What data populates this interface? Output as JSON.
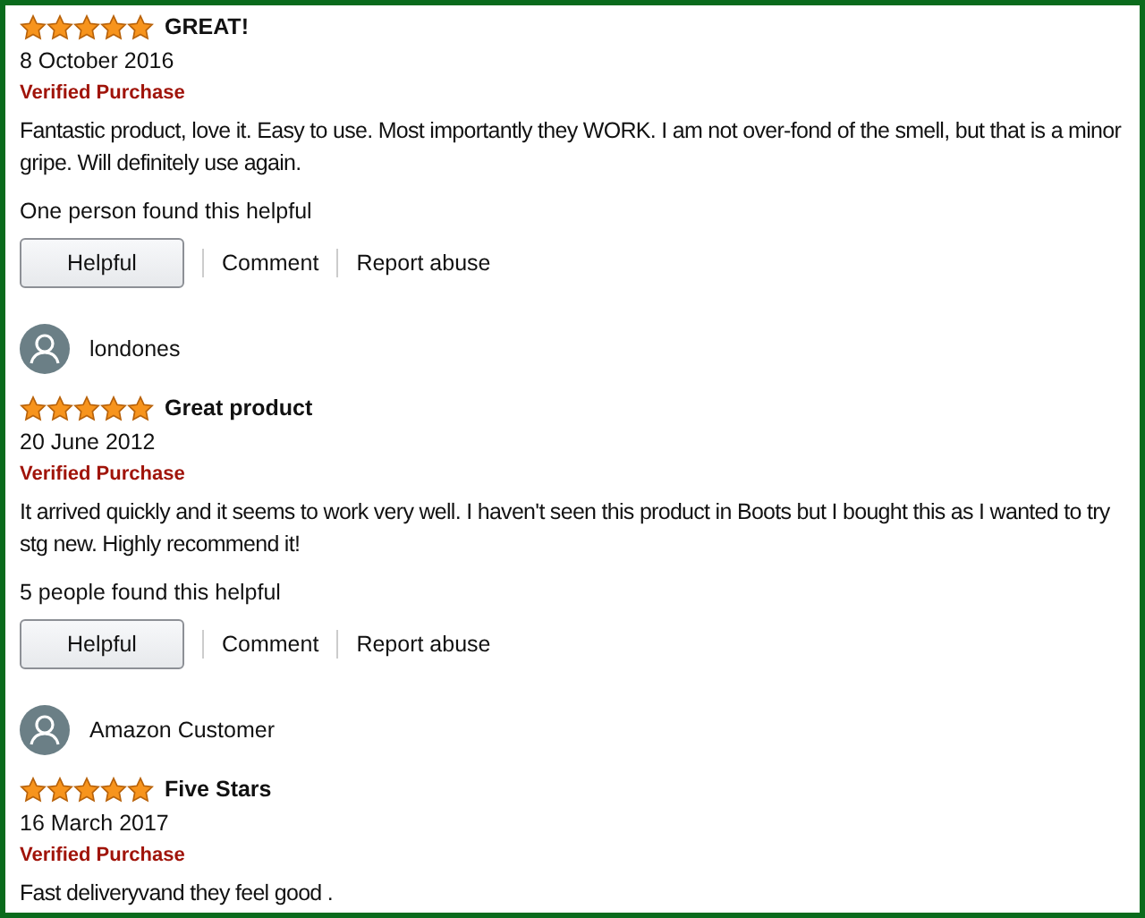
{
  "reviews": [
    {
      "stars": 5,
      "title": "GREAT!",
      "date": "8 October 2016",
      "badge": "Verified Purchase",
      "body": "Fantastic product, love it. Easy to use. Most importantly they WORK. I am not over-fond of the smell, but that is a minor gripe. Will definitely use again.",
      "helpful_count": "One person found this helpful",
      "actions": [
        "Helpful",
        "Comment",
        "Report abuse"
      ]
    },
    {
      "reviewer": "londones",
      "stars": 5,
      "title": "Great product",
      "date": "20 June 2012",
      "badge": "Verified Purchase",
      "body": "It arrived quickly and it seems to work very well. I haven't seen this product in Boots but I bought this as I wanted to try stg new. Highly recommend it!",
      "helpful_count": "5 people found this helpful",
      "actions": [
        "Helpful",
        "Comment",
        "Report abuse"
      ]
    },
    {
      "reviewer": "Amazon Customer",
      "stars": 5,
      "title": "Five Stars",
      "date": "16 March 2017",
      "badge": "Verified Purchase",
      "body": "Fast deliveryvand they feel good ."
    }
  ]
}
